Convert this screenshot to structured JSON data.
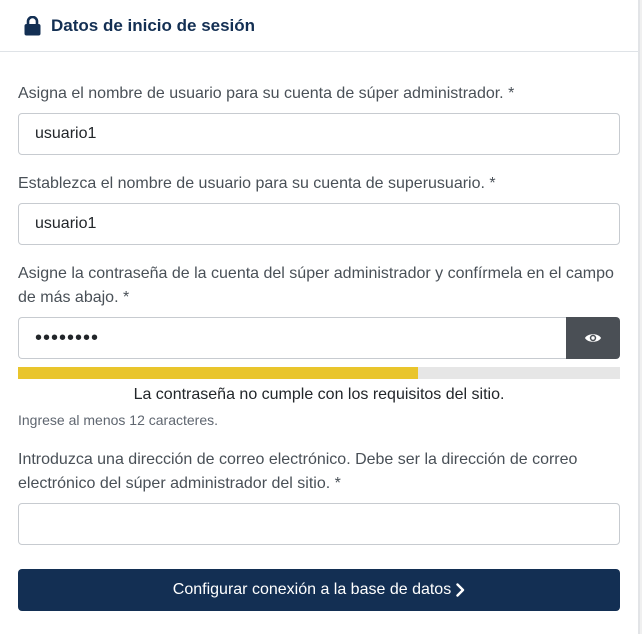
{
  "header": {
    "title": "Datos de inicio de sesión",
    "icon": "lock-icon"
  },
  "fields": {
    "admin_username": {
      "label": "Asigna el nombre de usuario para su cuenta de súper administrador. *",
      "value": "usuario1"
    },
    "superuser_username": {
      "label": "Establezca el nombre de usuario para su cuenta de superusuario. *",
      "value": "usuario1"
    },
    "password": {
      "label": "Asigne la contraseña de la cuenta del súper administrador y confírmela en el campo de más abajo. *",
      "value_masked": "••••••••",
      "toggle_icon": "eye-icon",
      "strength_fraction": 0.665,
      "strength_message": "La contraseña no cumple con los requisitos del sitio.",
      "hint": "Ingrese al menos 12 caracteres."
    },
    "email": {
      "label": "Introduzca una dirección de correo electrónico. Debe ser la dirección de correo electrónico del súper administrador del sitio. *",
      "value": ""
    }
  },
  "submit": {
    "label": "Configurar conexión a la base de datos",
    "icon": "chevron-right-icon"
  },
  "colors": {
    "primary": "#132f53",
    "meter_fill": "#e9c52c",
    "meter_track": "#e6e6e6",
    "toggle_bg": "#4a4f55"
  }
}
